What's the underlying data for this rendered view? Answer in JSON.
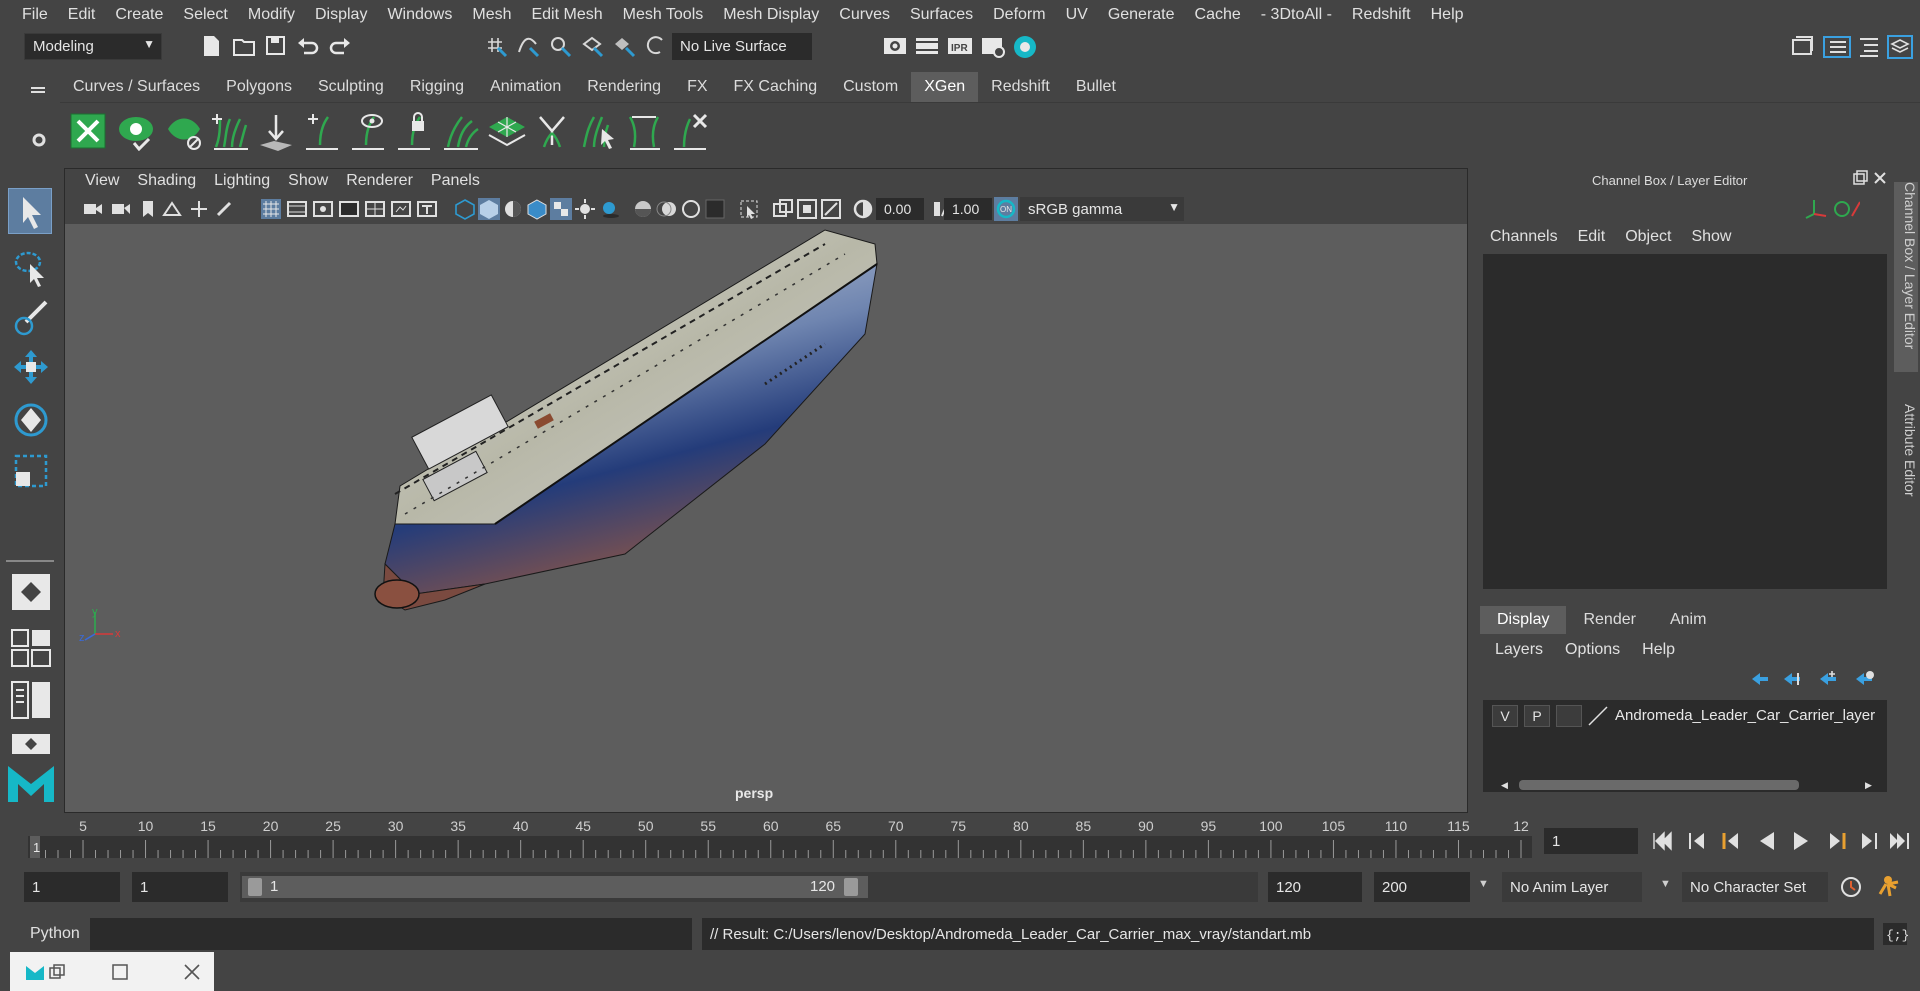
{
  "menubar": [
    "File",
    "Edit",
    "Create",
    "Select",
    "Modify",
    "Display",
    "Windows",
    "Mesh",
    "Edit Mesh",
    "Mesh Tools",
    "Mesh Display",
    "Curves",
    "Surfaces",
    "Deform",
    "UV",
    "Generate",
    "Cache",
    "- 3DtoAll -",
    "Redshift",
    "Help"
  ],
  "statusline": {
    "workspace": "Modeling",
    "live_surface": "No Live Surface"
  },
  "shelf": {
    "tabs": [
      "Curves / Surfaces",
      "Polygons",
      "Sculpting",
      "Rigging",
      "Animation",
      "Rendering",
      "FX",
      "FX Caching",
      "Custom",
      "XGen",
      "Redshift",
      "Bullet"
    ],
    "active_tab": "XGen"
  },
  "viewport": {
    "menu": [
      "View",
      "Shading",
      "Lighting",
      "Show",
      "Renderer",
      "Panels"
    ],
    "exposure": "0.00",
    "gamma": "1.00",
    "color_space": "sRGB gamma",
    "camera_label": "persp",
    "axis": {
      "x": "x",
      "y": "y",
      "z": "z"
    }
  },
  "right_panel": {
    "title": "Channel Box / Layer Editor",
    "channel_menu": [
      "Channels",
      "Edit",
      "Object",
      "Show"
    ],
    "layer_tabs": [
      "Display",
      "Render",
      "Anim"
    ],
    "active_layer_tab": "Display",
    "layer_menu": [
      "Layers",
      "Options",
      "Help"
    ],
    "layer": {
      "v": "V",
      "p": "P",
      "name": "Andromeda_Leader_Car_Carrier_layer"
    },
    "side_tabs": [
      "Channel Box / Layer Editor",
      "Attribute Editor"
    ]
  },
  "timeline": {
    "ticks": [
      "5",
      "10",
      "15",
      "20",
      "25",
      "30",
      "35",
      "40",
      "45",
      "50",
      "55",
      "60",
      "65",
      "70",
      "75",
      "80",
      "85",
      "90",
      "95",
      "100",
      "105",
      "110",
      "115",
      "12"
    ],
    "current_frame_marker": "1",
    "current_frame": "1"
  },
  "range": {
    "start": "1",
    "playback_start": "1",
    "slider_start": "1",
    "slider_end": "120",
    "playback_end": "120",
    "end": "200",
    "anim_layer": "No Anim Layer",
    "char_set": "No Character Set"
  },
  "command": {
    "language": "Python",
    "result": "// Result: C:/Users/lenov/Desktop/Andromeda_Leader_Car_Carrier_max_vray/standart.mb"
  },
  "colors": {
    "bg": "#444444",
    "viewport_bg": "#5d5d5d",
    "field_bg": "#2b2b2b",
    "accent_green": "#2fa84f",
    "accent_teal": "#16b8c7"
  }
}
